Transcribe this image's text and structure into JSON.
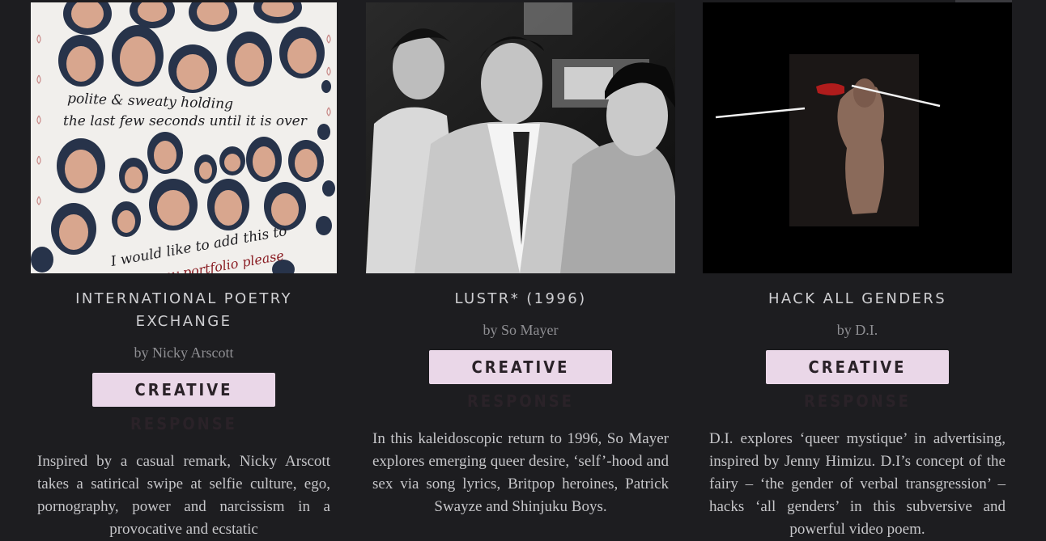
{
  "cards": [
    {
      "title": "INTERNATIONAL POETRY EXCHANGE",
      "author": "by Nicky Arscott",
      "button": "CREATIVE RESPONSE",
      "description": "Inspired by a casual remark, Nicky Arscott takes a satirical swipe at selfie culture, ego, pornography, power and narcissism in a provocative and ecstatic",
      "image_text_line1": "polite & sweaty holding",
      "image_text_line2": "the last few seconds until it is over",
      "image_text_line3": "I would like to add this to",
      "image_text_line4": "my portfolio please"
    },
    {
      "title": "LUSTR* (1996)",
      "author": "by So Mayer",
      "button": "CREATIVE RESPONSE",
      "description": "In this kaleidoscopic return to 1996, So Mayer explores emerging queer desire, ‘self’-hood and sex via song lyrics, Britpop heroines, Patrick Swayze and Shinjuku Boys."
    },
    {
      "title": "HACK ALL GENDERS",
      "author": "by D.I.",
      "button": "CREATIVE RESPONSE",
      "description": "D.I. explores ‘queer mystique’ in advertising, inspired by Jenny Himizu. D.I’s concept of the fairy – ‘the gender of verbal transgression’ – hacks ‘all genders’ in this subversive and powerful video poem."
    }
  ],
  "colors": {
    "background": "#1d1d20",
    "button_bg": "#ead7e8",
    "button_text": "#2a2228"
  }
}
